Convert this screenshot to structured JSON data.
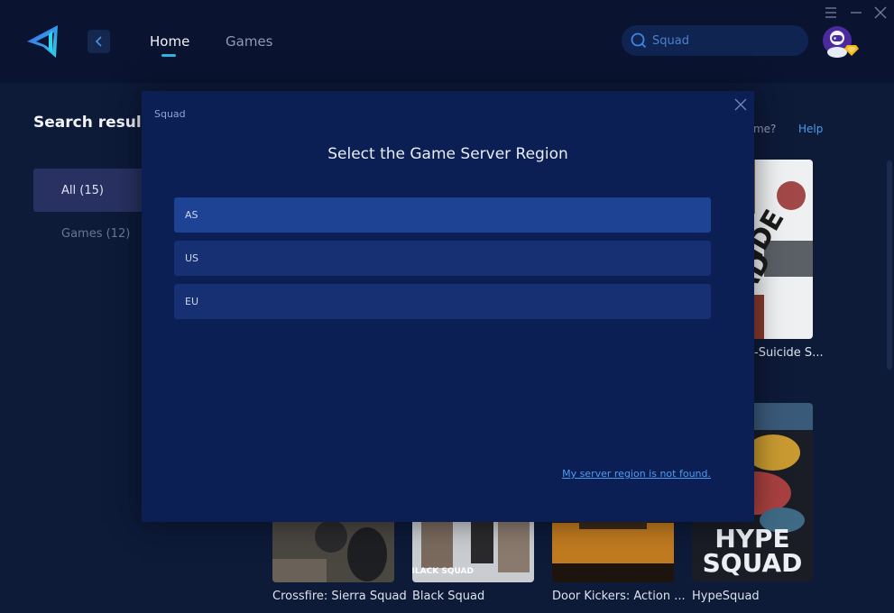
{
  "header": {
    "nav": [
      {
        "label": "Home",
        "active": true
      },
      {
        "label": "Games",
        "active": false
      }
    ],
    "search": {
      "value": "Squad",
      "placeholder": "Squad"
    },
    "window_controls": [
      "menu-icon",
      "minimize-icon",
      "close-icon"
    ]
  },
  "sidebar": {
    "title": "Search results",
    "filters": [
      {
        "label": "All (15)",
        "active": true
      },
      {
        "label": "Games (12)",
        "active": false
      }
    ]
  },
  "main": {
    "missing_game_text": "game?",
    "help_label": "Help",
    "cards": [
      {
        "title": "-Suicide S...",
        "art": "suicide-squad"
      },
      {
        "title": "Crossfire: Sierra Squad",
        "art": "crossfire"
      },
      {
        "title": "Black Squad",
        "art": "black-squad",
        "art_text": "BLACK SQUAD"
      },
      {
        "title": "Door Kickers: Action ...",
        "art": "door-kickers"
      },
      {
        "title": "HypeSquad",
        "art": "hypesquad",
        "art_text_1": "HYPE",
        "art_text_2": "SQUAD"
      }
    ]
  },
  "modal": {
    "subtitle": "Squad",
    "title": "Select the Game Server Region",
    "regions": [
      {
        "label": "AS",
        "selected": true
      },
      {
        "label": "US",
        "selected": false
      },
      {
        "label": "EU",
        "selected": false
      }
    ],
    "not_found_link": "My server region is not found."
  },
  "colors": {
    "background": "#0d1a38",
    "topbar": "#0a1330",
    "accent": "#34b3e0",
    "modal_bg": "#0b1f55",
    "region_selected": "#1e4395",
    "region_normal": "#172f73",
    "link": "#4d9cf0"
  }
}
